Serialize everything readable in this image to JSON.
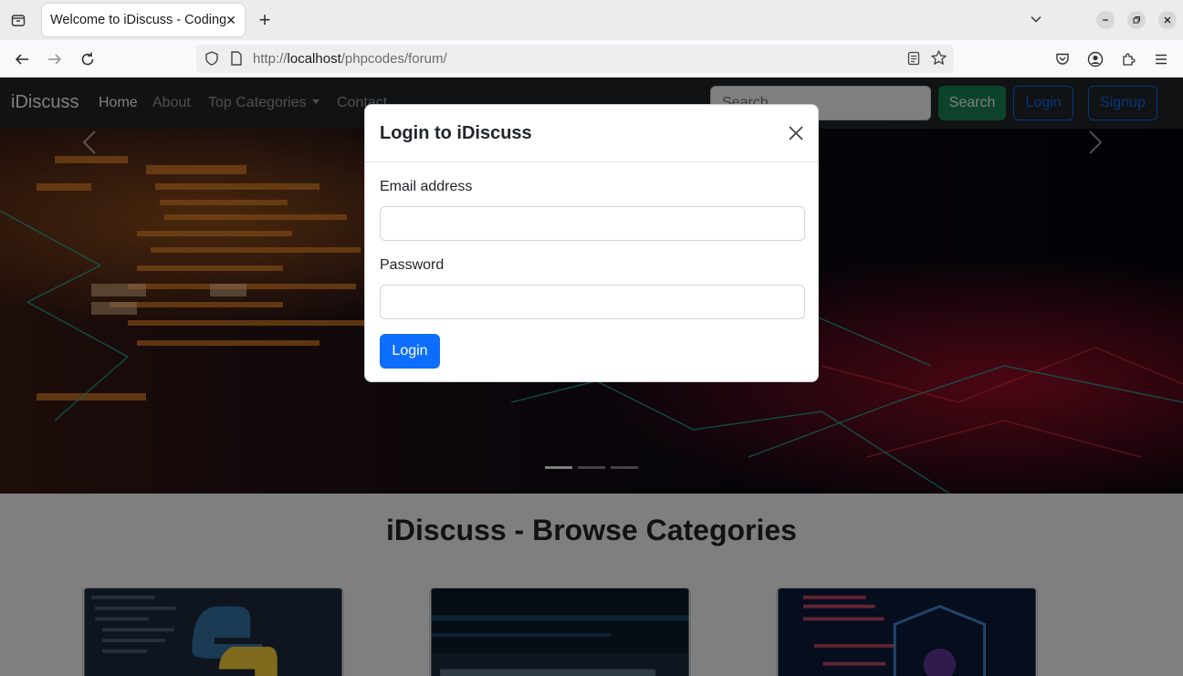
{
  "browser": {
    "tab_title": "Welcome to iDiscuss - Coding",
    "url_prefix": "http://",
    "url_host": "localhost",
    "url_path": "/phpcodes/forum/"
  },
  "site": {
    "brand": "iDiscuss",
    "nav_links": [
      "Home",
      "About",
      "Top Categories",
      "Contact"
    ],
    "search_placeholder": "Search",
    "search_button": "Search",
    "login_button": "Login",
    "signup_button": "Signup"
  },
  "main": {
    "section_title": "iDiscuss - Browse Categories"
  },
  "login_modal": {
    "title": "Login to iDiscuss",
    "email_label": "Email address",
    "password_label": "Password",
    "submit_label": "Login"
  },
  "colors": {
    "navbar_bg": "#212529",
    "search_green": "#198754",
    "primary_blue": "#0d6efd"
  }
}
